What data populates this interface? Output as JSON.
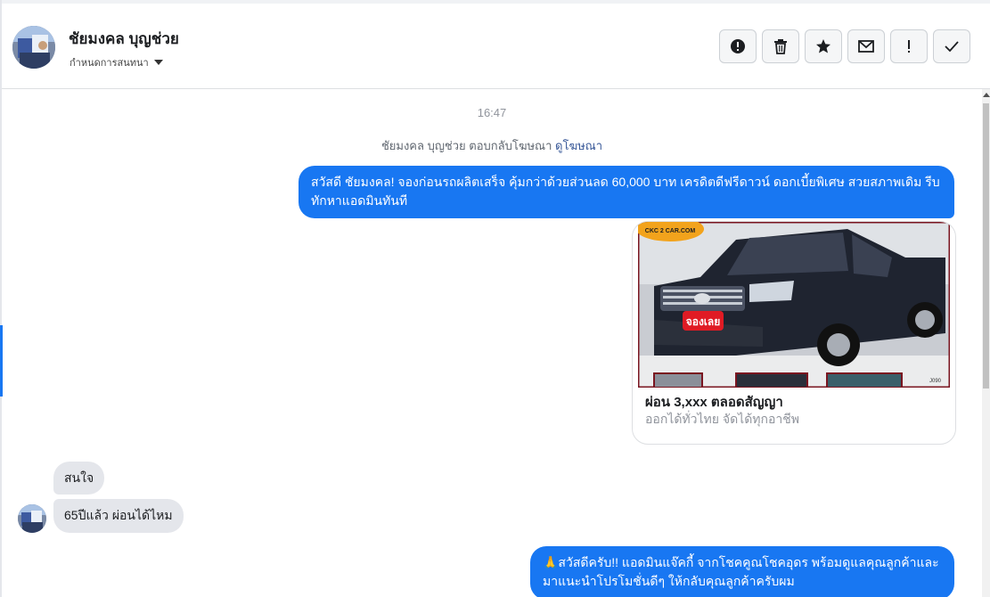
{
  "header": {
    "contact_name": "ชัยมงคล บุญช่วย",
    "assign_label": "กำหนดการสนทนา",
    "actions": [
      {
        "name": "report-spam-button",
        "icon": "alert-circle-icon"
      },
      {
        "name": "delete-button",
        "icon": "trash-icon"
      },
      {
        "name": "star-button",
        "icon": "star-icon"
      },
      {
        "name": "mark-unread-button",
        "icon": "envelope-icon"
      },
      {
        "name": "follow-up-button",
        "icon": "exclamation-icon"
      },
      {
        "name": "mark-done-button",
        "icon": "check-icon"
      }
    ]
  },
  "conversation": {
    "timestamp": "16:47",
    "ad_reply_text": "ชัยมงคล บุญช่วย ตอบกลับโฆษณา",
    "ad_reply_link": "ดูโฆษณา",
    "messages": [
      {
        "direction": "outgoing",
        "text": "สวัสดี ชัยมงคล! จองก่อนรถผลิตเสร็จ คุ้มกว่าด้วยส่วนลด 60,000 บาท เครดิตดีฟรีดาวน์ ดอกเบี้ยพิเศษ สวยสภาพเดิม รีบทักหาแอดมินทันที"
      },
      {
        "direction": "incoming",
        "text": "สนใจ"
      },
      {
        "direction": "incoming",
        "text": "65ปีแล้ว ผ่อนได้ไหม"
      },
      {
        "direction": "outgoing",
        "text": "🙏สวัสดีครับ!! แอดมินแจ๊คกี้ จากโชคคูณโชคอุดร พร้อมดูแลคุณลูกค้าและมาแนะนำโปรโมชั่นดีๆ ให้กลับคุณลูกค้าครับผม"
      }
    ],
    "ad_card": {
      "title": "ผ่อน 3,xxx ตลอดสัญญา",
      "subtitle": "ออกได้ทั่วไทย จัดได้ทุกอาชีพ",
      "image_logo": "CKC 2 CAR.COM",
      "image_badge": "จองเลย",
      "image_code": "J090"
    }
  },
  "colors": {
    "accent": "#1877f2",
    "incoming_bubble": "#e4e6eb",
    "link": "#385898"
  }
}
